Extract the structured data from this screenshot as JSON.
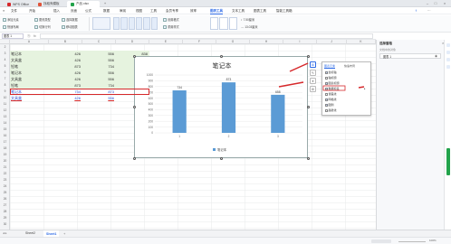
{
  "tabs": [
    {
      "label": "WPS Office",
      "color": "#d6282b"
    },
    {
      "label": "找稻壳模板",
      "color": "#e0543a"
    },
    {
      "label": "产品.xlsx",
      "color": "#22a34b"
    }
  ],
  "menus": [
    "文件",
    "开始",
    "插入",
    "页面",
    "公式",
    "数据",
    "审阅",
    "视图",
    "工具",
    "会员专享",
    "效率",
    "图表工具",
    "文本工具",
    "图表工具",
    "智能工具箱"
  ],
  "menu_selected_index": 11,
  "ribbon": {
    "add_element": "添加元素",
    "quick_layout": "快速布局",
    "change_type": "更改类型",
    "switch_rowcol": "切换行列",
    "select_data": "选择数据",
    "move_chart": "移动图表",
    "set_format": "设置格式",
    "reset_style": "重置样式",
    "height": "7.50厘米",
    "width": "13.03厘米"
  },
  "formula_bar": {
    "name_box": "图表 1",
    "fx": "fx"
  },
  "columns": [
    "A",
    "B",
    "C",
    "D",
    "E",
    "F",
    "G",
    "H",
    "I",
    "J",
    "K",
    "L",
    "M",
    "N",
    "O",
    "P"
  ],
  "rows": [
    "2",
    "3",
    "4",
    "5",
    "6",
    "7",
    "8",
    "9",
    "10",
    "11",
    "12",
    "13",
    "14",
    "15",
    "16",
    "17",
    "18",
    "19",
    "20",
    "21",
    "22",
    "23",
    "24",
    "25",
    "26",
    "27",
    "28",
    "29",
    "30"
  ],
  "table": [
    {
      "name": "笔记本",
      "b": "426",
      "c": "556",
      "d": "838"
    },
    {
      "name": "文具盒",
      "b": "426",
      "c": "556",
      "d": "748"
    },
    {
      "name": "铅笔",
      "b": "873",
      "c": "734",
      "d": "589"
    },
    {
      "name": "笔记本",
      "b": "426",
      "c": "556",
      "d": "838"
    },
    {
      "name": "文具盒",
      "b": "426",
      "c": "556",
      "d": "748"
    },
    {
      "name": "铅笔",
      "b": "873",
      "c": "734",
      "d": "965"
    },
    {
      "name": "笔记本",
      "b": "734",
      "c": "873",
      "d": "658"
    },
    {
      "name": "文具盒",
      "b": "426",
      "c": "556",
      "d": "838"
    }
  ],
  "chart_data": {
    "type": "bar",
    "title": "笔记本",
    "categories": [
      "1",
      "2",
      "3"
    ],
    "series": [
      {
        "name": "笔记本",
        "values": [
          734,
          873,
          658
        ]
      }
    ],
    "ylim": [
      0,
      1000
    ],
    "yticks": [
      "0",
      "100",
      "200",
      "300",
      "400",
      "500",
      "600",
      "700",
      "800",
      "900",
      "1000"
    ],
    "bar_color": "#5b9bd5",
    "legend_position": "bottom",
    "grid": true
  },
  "chart_elements_popup": {
    "tabs": [
      "图表元素",
      "快速布局"
    ],
    "items": [
      {
        "label": "坐标轴",
        "checked": true
      },
      {
        "label": "轴标题",
        "checked": false
      },
      {
        "label": "图表标题",
        "checked": true
      },
      {
        "label": "数据标签",
        "checked": true
      },
      {
        "label": "误差线",
        "checked": false
      },
      {
        "label": "网格线",
        "checked": true
      },
      {
        "label": "图例",
        "checked": true
      },
      {
        "label": "趋势线",
        "checked": false
      }
    ]
  },
  "right_panel": {
    "title": "选择窗格",
    "subtitle": "文档中的对象",
    "item": "图表 1"
  },
  "sheets": [
    {
      "label": "Sheet2",
      "active": false
    },
    {
      "label": "Sheet1",
      "active": true
    }
  ],
  "status": {
    "mode": "",
    "zoom": "100%"
  },
  "colors": {
    "accent": "#2f6be6",
    "red": "#d6282b",
    "green_fill": "#e6f3df"
  }
}
